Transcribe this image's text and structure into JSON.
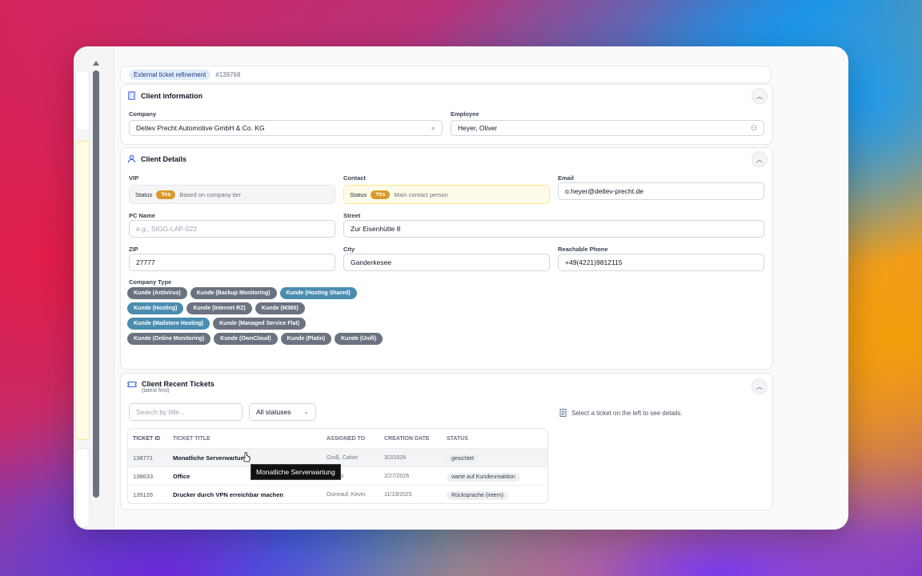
{
  "header": {
    "badge": "External ticket refinement",
    "ticket_number": "#139768"
  },
  "client_info": {
    "title": "Client information",
    "company_label": "Company",
    "company_value": "Detlev Precht Automotive GmbH & Co. KG",
    "employee_label": "Employee",
    "employee_value": "Heyer, Oliver"
  },
  "client_details": {
    "title": "Client Details",
    "vip": {
      "label": "VIP",
      "status_label": "Status",
      "badge": "Yes",
      "note": "Based on company tier"
    },
    "contact": {
      "label": "Contact",
      "status_label": "Status",
      "badge": "Yes",
      "note": "Main contact person"
    },
    "email": {
      "label": "Email",
      "value": "o.heyer@detlev-precht.de"
    },
    "pc_name": {
      "label": "PC Name",
      "placeholder": "e.g., SIGG-LAP-022"
    },
    "street": {
      "label": "Street",
      "value": "Zur Eisenhütte 8"
    },
    "zip": {
      "label": "ZIP",
      "value": "27777"
    },
    "city": {
      "label": "City",
      "value": "Ganderkesee"
    },
    "phone": {
      "label": "Reachable Phone",
      "value": "+49(4221)9812115"
    },
    "company_type_label": "Company Type",
    "company_types": [
      {
        "label": "Kunde (Antivirus)",
        "color": "#6b7280"
      },
      {
        "label": "Kunde (Backup Monitoring)",
        "color": "#6b7280"
      },
      {
        "label": "Kunde (Hosting Shared)",
        "color": "#4b8db0"
      },
      {
        "label": "Kunde (Hosting)",
        "color": "#4b8db0"
      },
      {
        "label": "Kunde (Internet RZ)",
        "color": "#6b7280"
      },
      {
        "label": "Kunde (M365)",
        "color": "#6b7280"
      },
      {
        "label": "Kunde (Mailstore Hosting)",
        "color": "#4b8db0"
      },
      {
        "label": "Kunde (Managed Service Flat)",
        "color": "#6b7280"
      },
      {
        "label": "Kunde (Online Monitoring)",
        "color": "#6b7280"
      },
      {
        "label": "Kunde (OwnCloud)",
        "color": "#6b7280"
      },
      {
        "label": "Kunde (Platin)",
        "color": "#6b7280"
      },
      {
        "label": "Kunde (Unifi)",
        "color": "#6b7280"
      }
    ]
  },
  "recent_tickets": {
    "title": "Client Recent Tickets",
    "subtitle": "(latest first)",
    "search_placeholder": "Search by title...",
    "status_filter": "All statuses",
    "hint": "Select a ticket on the left to see details.",
    "columns": [
      "TICKET ID",
      "TICKET TITLE",
      "ASSIGNED TO",
      "CREATION DATE",
      "STATUS"
    ],
    "rows": [
      {
        "id": "138771",
        "title": "Monatliche Serverwartung",
        "assigned": "Groß, Calvin",
        "date": "3/2/2026",
        "status": "gesichtet"
      },
      {
        "id": "138633",
        "title": "Office",
        "assigned": "Philipp",
        "date": "2/27/2026",
        "status": "warte auf Kundenreaktion"
      },
      {
        "id": "135126",
        "title": "Drucker durch VPN erreichbar machen",
        "assigned": "Dumrauf, Kevin",
        "date": "11/19/2025",
        "status": "Rücksprache (intern)"
      }
    ],
    "tooltip": "Monatliche Serverwartung"
  }
}
